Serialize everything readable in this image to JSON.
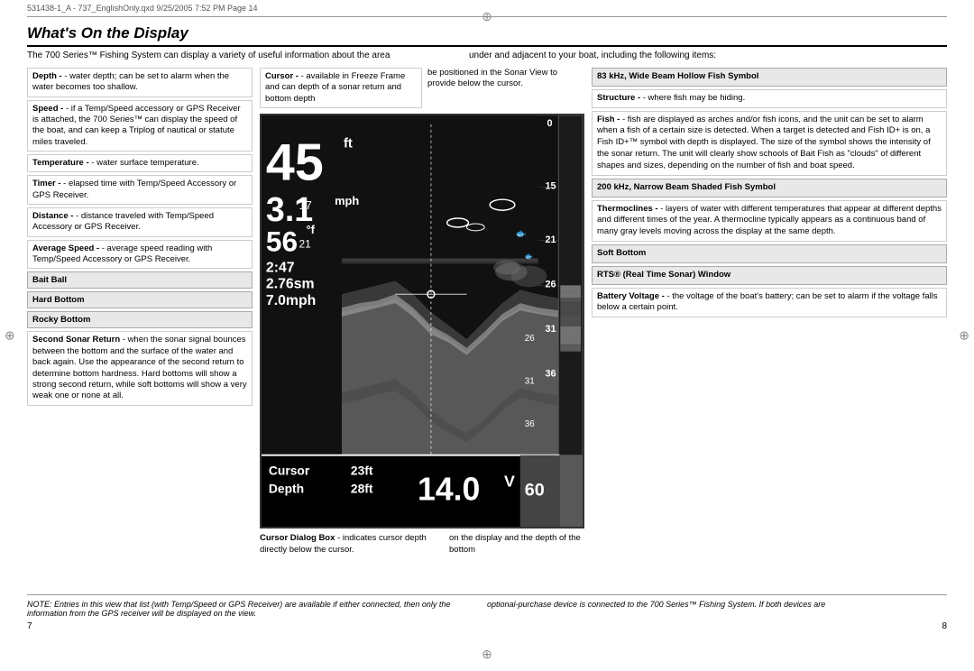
{
  "header": {
    "file_info": "531438-1_A  -  737_EnglishOnly.qxd   9/25/2005   7:52 PM   Page 14"
  },
  "page_title": "What's On the Display",
  "intro": {
    "left": "The 700 Series™ Fishing System can display a variety of useful information about the area",
    "right": "under and adjacent to your boat, including the following items:"
  },
  "left_column": {
    "depth_box": {
      "label": "Depth",
      "text": "- water depth; can be set to alarm when the water becomes too shallow."
    },
    "speed_box": {
      "label": "Speed",
      "text": "- if a Temp/Speed accessory or GPS Receiver is attached, the 700 Series™ can display the speed of the boat, and can keep a Triplog of nautical or statute miles traveled."
    },
    "temp_box": {
      "label": "Temperature",
      "text": "- water surface temperature."
    },
    "timer_box": {
      "label": "Timer",
      "text": "- elapsed time with Temp/Speed Accessory or GPS Receiver."
    },
    "distance_box": {
      "label": "Distance",
      "text": "- distance traveled with Temp/Speed Accessory or GPS Receiver."
    },
    "avg_speed_box": {
      "label": "Average Speed",
      "text": "- average speed reading with Temp/Speed Accessory or GPS Receiver."
    },
    "bait_ball_label": "Bait Ball",
    "hard_bottom_label": "Hard Bottom",
    "rocky_bottom_label": "Rocky Bottom",
    "second_sonar_box": {
      "label": "Second Sonar Return",
      "text": "- when the sonar signal bounces between the bottom and the surface of the water and back again. Use the appearance of the second return to determine bottom hardness. Hard bottoms will show a strong second return, while soft bottoms will show a very weak one or none at all."
    }
  },
  "sonar_display": {
    "depth_value": "45",
    "depth_unit": "ft",
    "speed_value": "3.1",
    "speed_unit": "mph",
    "temp_value": "56",
    "temp_unit": "°f",
    "time_value": "2:47",
    "sm_value": "2.76sm",
    "speed2_value": "7.0mph",
    "depth_scale": [
      "0",
      "15",
      "21",
      "26",
      "31",
      "36",
      "60"
    ],
    "cursor_label": "Cursor",
    "depth_label": "Depth",
    "cursor_depth": "23ft",
    "depth_bottom": "28ft",
    "voltage": "14.0",
    "voltage_unit": "V",
    "scale_60": "60"
  },
  "sonar_caption": {
    "left_label": "Cursor Dialog Box",
    "left_text": "- indicates cursor depth directly below the cursor.",
    "right_text": "on the display and the depth of the bottom"
  },
  "center_column": {
    "cursor_box": {
      "label": "Cursor",
      "text": "- available in Freeze Frame and can depth of a sonar return and bottom depth"
    },
    "cursor_right": "be positioned in the Sonar View to provide below the cursor."
  },
  "right_column": {
    "fish_symbol_label": "83 kHz, Wide Beam Hollow Fish Symbol",
    "structure_box": {
      "label": "Structure",
      "text": "- where fish may be hiding."
    },
    "fish_box": {
      "label": "Fish",
      "text": "- fish are displayed as arches and/or fish icons, and the unit can be set to alarm when a fish of a certain size is detected. When a target is detected and Fish ID+ is on, a Fish ID+™ symbol with depth is displayed. The size of the symbol shows the intensity of the sonar return. The unit will clearly show schools of Bait Fish as \"clouds\" of different shapes and sizes, depending on the number of fish and boat speed."
    },
    "narrow_fish_label": "200 kHz, Narrow Beam Shaded Fish Symbol",
    "thermocline_box": {
      "label": "Thermoclines",
      "text": "- layers of water with different temperatures that appear at different depths and different times of the year. A thermocline typically appears as a continuous band of many gray levels moving across the display at the same depth."
    },
    "soft_bottom_label": "Soft Bottom",
    "rts_label": "RTS® (Real Time Sonar) Window",
    "battery_box": {
      "label": "Battery Voltage",
      "text": "- the voltage of the boat's battery; can be set to alarm if the voltage falls below a certain point."
    }
  },
  "note": {
    "left": "NOTE: Entries in this view that list (with Temp/Speed or GPS Receiver) are available if either connected, then only the information from the GPS receiver will be displayed on the view.",
    "right": "optional-purchase device is connected to the 700 Series™ Fishing System.  If both devices are"
  },
  "page_numbers": {
    "left": "7",
    "right": "8"
  }
}
